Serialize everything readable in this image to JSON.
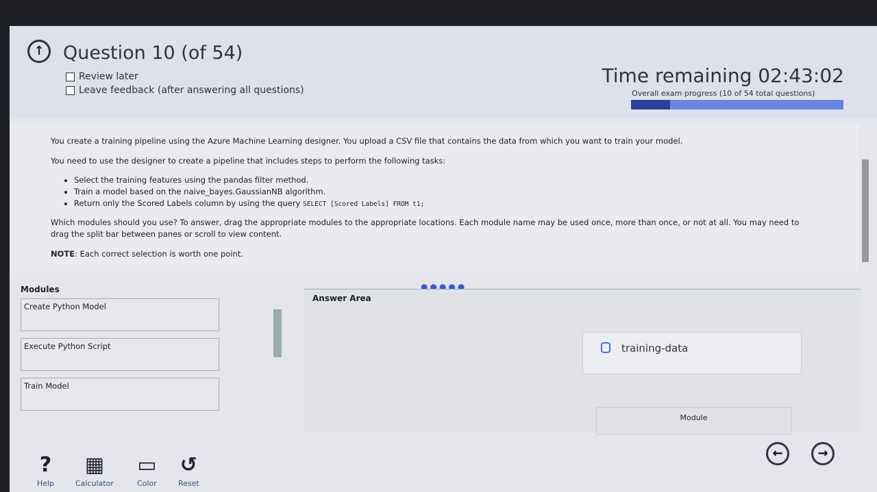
{
  "header": {
    "title": "Question 10 (of 54)",
    "review_later": "Review later",
    "leave_feedback": "Leave feedback (after answering all questions)",
    "time_remaining": "Time remaining 02:43:02",
    "progress_label": "Overall exam progress (10 of 54 total questions)",
    "progress_fraction": 0.185
  },
  "question": {
    "p1": "You create a training pipeline using the Azure Machine Learning designer. You upload a CSV file that contains the data from which you want to train your model.",
    "p2": "You need to use the designer to create a pipeline that includes steps to perform the following tasks:",
    "bullets": [
      "Select the training features using the pandas filter method.",
      "Train a model based on the naive_bayes.GaussianNB algorithm.",
      "Return only the Scored Labels column by using the query "
    ],
    "query": "SELECT [Scored Labels] FROM t1;",
    "p3": "Which modules should you use? To answer, drag the appropriate modules to the appropriate locations. Each module name may be used once, more than once, or not at all. You may need to drag the split bar between panes or scroll to view content.",
    "note_label": "NOTE",
    "note": ": Each correct selection is worth one point."
  },
  "modules": {
    "heading": "Modules",
    "items": [
      "Create Python Model",
      "Execute Python Script",
      "Train Model"
    ]
  },
  "answer": {
    "heading": "Answer Area",
    "node1": "training-data",
    "node2": "Module"
  },
  "footer": {
    "help": "Help",
    "calculator": "Calculator",
    "color": "Color",
    "reset": "Reset"
  }
}
